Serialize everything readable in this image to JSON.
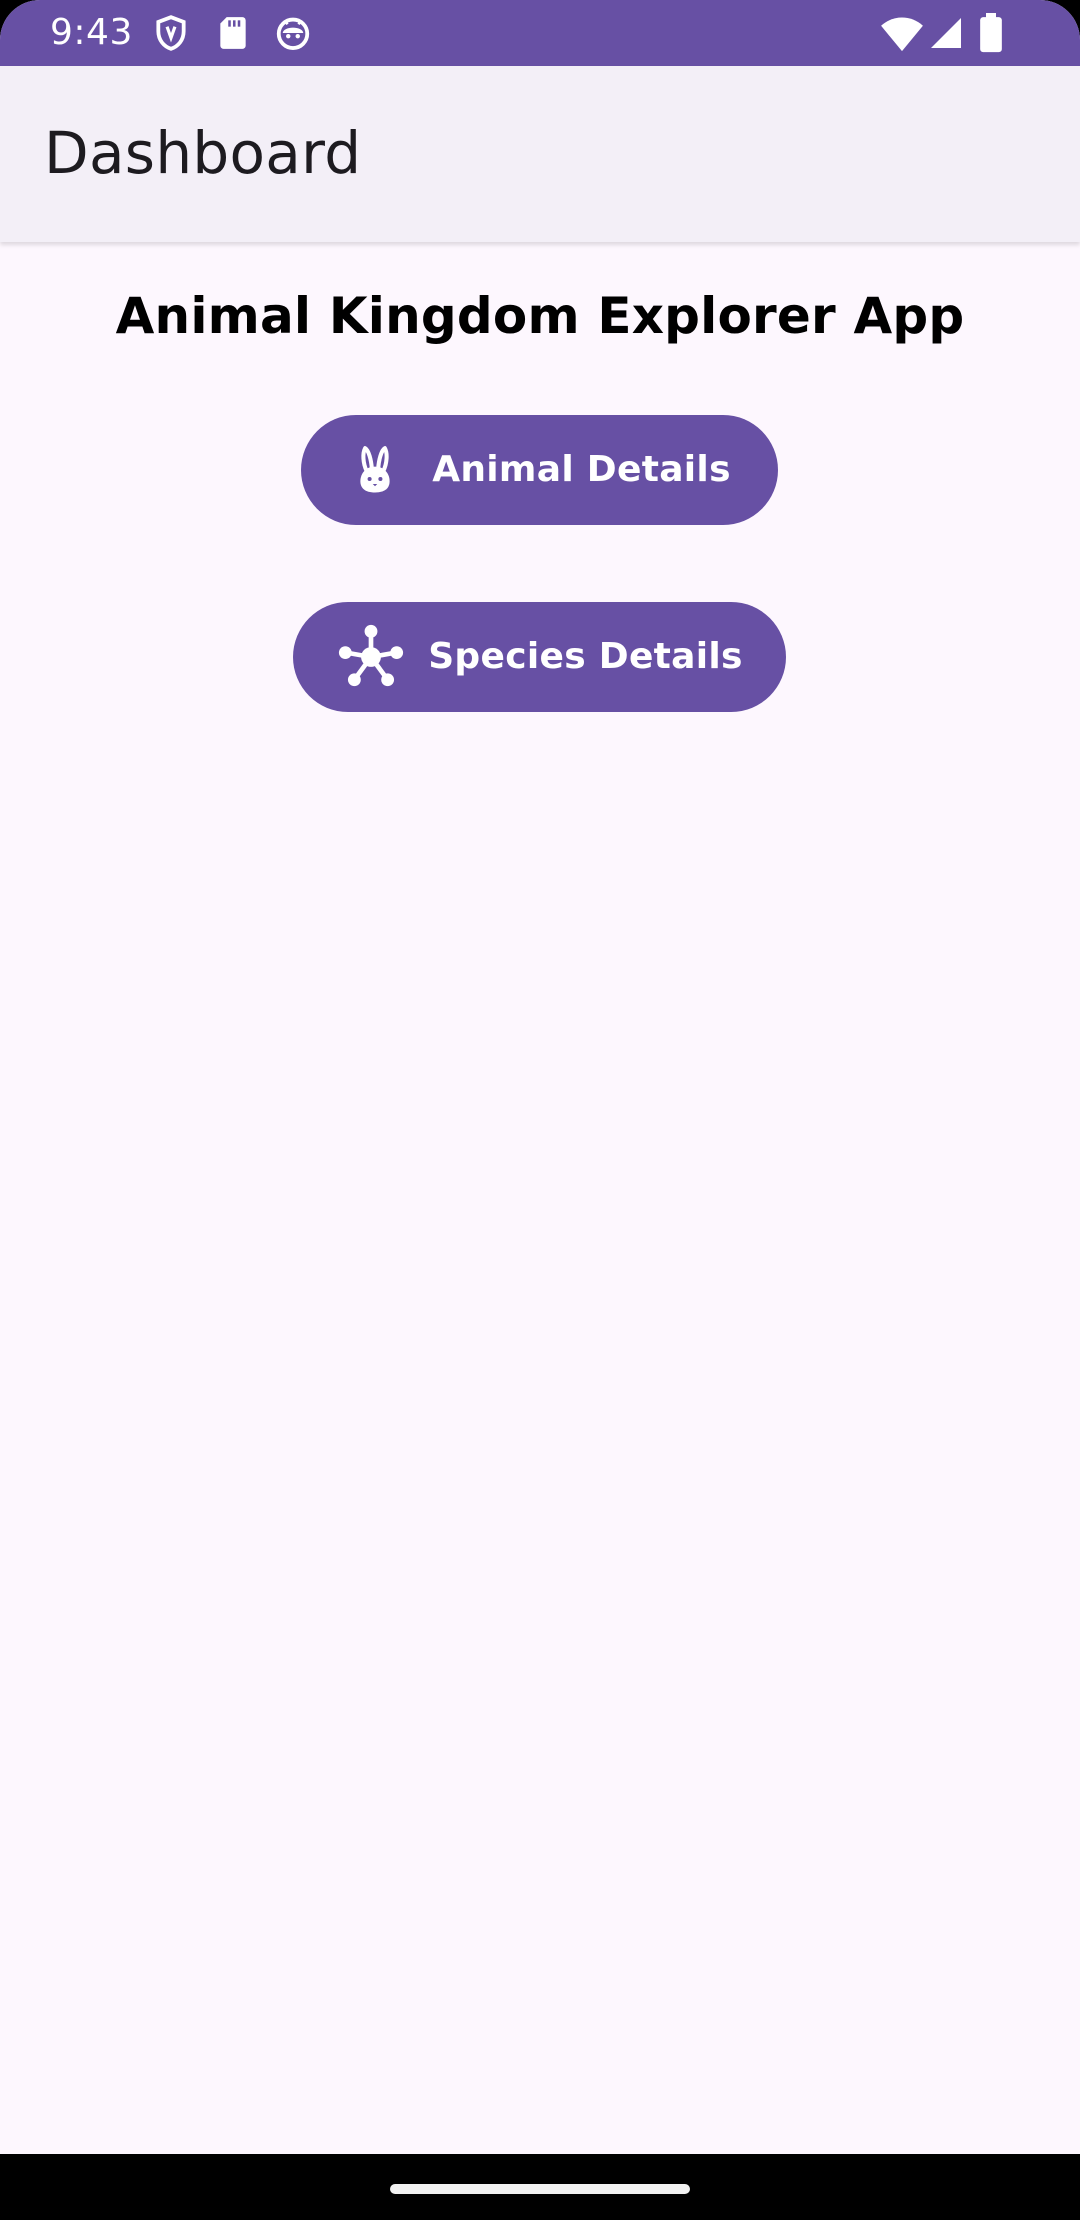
{
  "status_bar": {
    "time": "9:43",
    "icons_left": [
      "shield-icon",
      "sd-card-icon",
      "robot-face-icon"
    ],
    "icons_right": [
      "wifi-icon",
      "cell-signal-icon",
      "battery-icon"
    ],
    "background": "#6750A4"
  },
  "app_bar": {
    "title": "Dashboard",
    "background": "#F3EFF7"
  },
  "main": {
    "heading": "Animal Kingdom Explorer App",
    "buttons": [
      {
        "label": "Animal Details",
        "icon": "rabbit-icon"
      },
      {
        "label": "Species Details",
        "icon": "network-icon"
      }
    ]
  },
  "colors": {
    "primary": "#6750A4",
    "surface": "#FDF7FE",
    "on_primary": "#FFFFFF",
    "on_surface": "#1D1B20"
  }
}
